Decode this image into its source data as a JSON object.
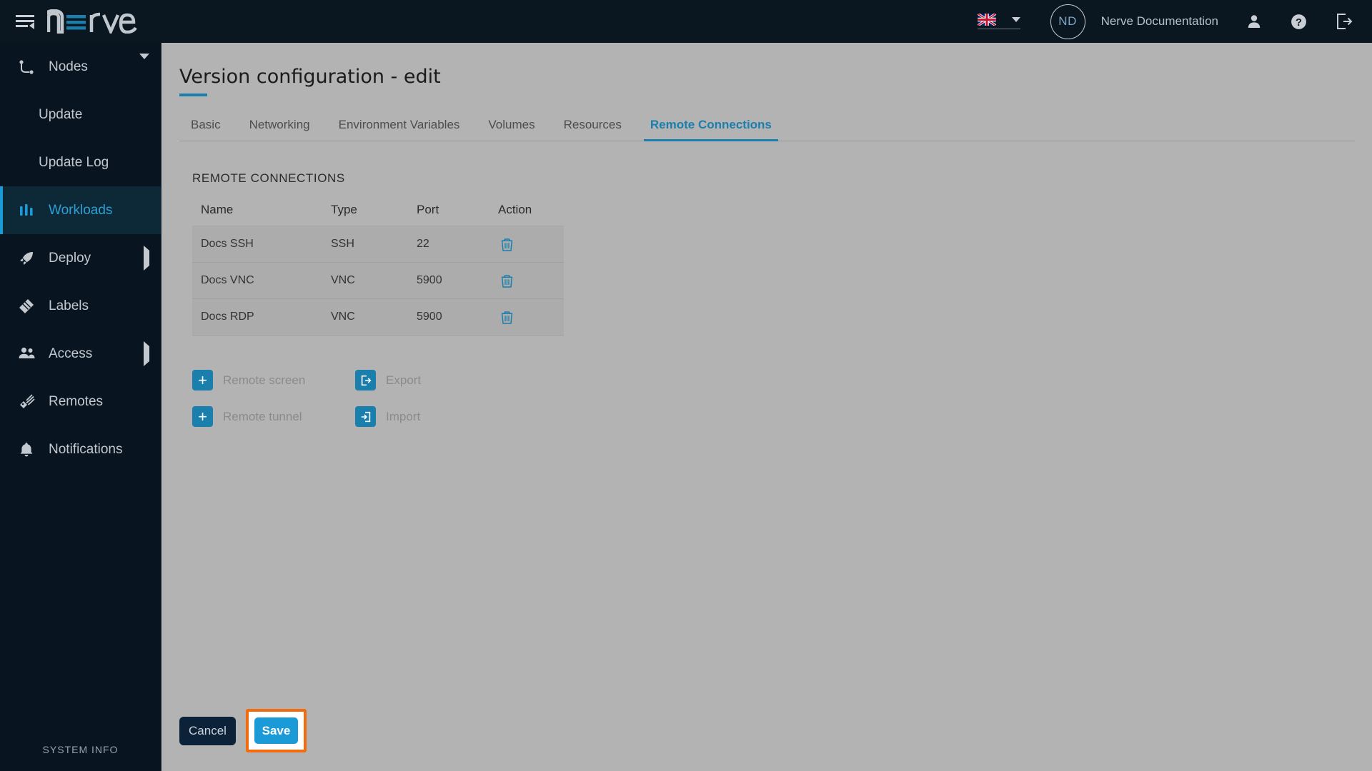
{
  "topbar": {
    "menu_icon": "hamburger-collapse-icon",
    "brand": "nerve",
    "language": {
      "value": "English (UK)",
      "flag": "uk-flag-icon"
    },
    "avatar_initials": "ND",
    "user_name": "Nerve Documentation",
    "icons": [
      "user-icon",
      "help-icon",
      "logout-icon"
    ]
  },
  "sidebar": {
    "items": [
      {
        "label": "Nodes",
        "icon": "nodes-icon",
        "expand": "down",
        "active": false,
        "sub": false
      },
      {
        "label": "Update",
        "icon": "",
        "expand": "",
        "active": false,
        "sub": true
      },
      {
        "label": "Update Log",
        "icon": "",
        "expand": "",
        "active": false,
        "sub": true
      },
      {
        "label": "Workloads",
        "icon": "workloads-icon",
        "expand": "",
        "active": true,
        "sub": false
      },
      {
        "label": "Deploy",
        "icon": "deploy-rocket-icon",
        "expand": "right",
        "active": false,
        "sub": false
      },
      {
        "label": "Labels",
        "icon": "labels-tag-icon",
        "expand": "",
        "active": false,
        "sub": false
      },
      {
        "label": "Access",
        "icon": "access-users-icon",
        "expand": "right",
        "active": false,
        "sub": false
      },
      {
        "label": "Remotes",
        "icon": "remotes-icon",
        "expand": "",
        "active": false,
        "sub": false
      },
      {
        "label": "Notifications",
        "icon": "bell-icon",
        "expand": "",
        "active": false,
        "sub": false
      }
    ],
    "system_info": "SYSTEM INFO"
  },
  "main": {
    "title": "Version configuration - edit",
    "tabs": [
      {
        "label": "Basic",
        "active": false
      },
      {
        "label": "Networking",
        "active": false
      },
      {
        "label": "Environment Variables",
        "active": false
      },
      {
        "label": "Volumes",
        "active": false
      },
      {
        "label": "Resources",
        "active": false
      },
      {
        "label": "Remote Connections",
        "active": true
      }
    ],
    "section_label": "REMOTE CONNECTIONS",
    "table": {
      "columns": [
        "Name",
        "Type",
        "Port",
        "Action"
      ],
      "rows": [
        {
          "name": "Docs SSH",
          "type": "SSH",
          "port": "22"
        },
        {
          "name": "Docs VNC",
          "type": "VNC",
          "port": "5900"
        },
        {
          "name": "Docs RDP",
          "type": "VNC",
          "port": "5900"
        }
      ],
      "row_action_icon": "trash-icon"
    },
    "actions": [
      {
        "label": "Remote screen",
        "icon": "plus-icon"
      },
      {
        "label": "Export",
        "icon": "export-icon"
      },
      {
        "label": "Remote tunnel",
        "icon": "plus-icon"
      },
      {
        "label": "Import",
        "icon": "import-icon"
      }
    ],
    "footer": {
      "cancel_label": "Cancel",
      "save_label": "Save",
      "save_highlight_color": "#f26b0f"
    }
  },
  "colors": {
    "accent_blue": "#1a9ad7",
    "tab_active": "#1a7fad",
    "sidebar_bg": "#081520",
    "topbar_bg": "#0a1620",
    "page_bg": "#b3b3b3",
    "highlight_orange": "#f26b0f"
  }
}
